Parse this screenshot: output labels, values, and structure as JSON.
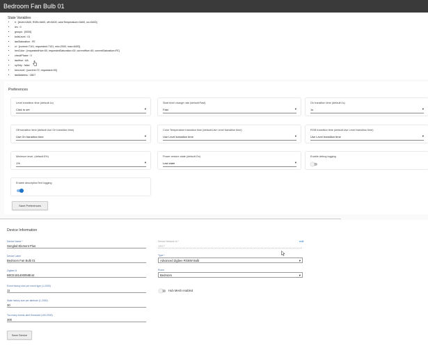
{
  "window": {
    "title": "Bedroom Fan Bulb 01"
  },
  "state": {
    "title": "State Variables",
    "items": [
      "rl : [level=0A00, RGB=0A00, off=0A00, colorTemperature=0A00, on=0A00]",
      "lim : 0",
      "groups : [0000]",
      "bulbLevel : 01",
      "lastSaturation : FE",
      "ct : [current=7101, requested=7101, min=2000, max=6493]",
      "hexColor : [requestedHue=00, requestedSaturation=00, currentHue=49, currentSaturation=FE]",
      "checkPhase : 0",
      "lastHue : AA",
      "xyOnly : false",
      "hexLevel : [current=72, requested=00]",
      "lastAddress : 1B27"
    ]
  },
  "preferences": {
    "title": "Preferences",
    "cards": [
      {
        "label": "Level transition time (default:1s)",
        "value": "Click to set"
      },
      {
        "label": "Start level change rate (default:Fast)",
        "value": "Fast"
      },
      {
        "label": "On transition time (default:1s)",
        "value": "1s"
      },
      {
        "label": "Off transition time (default:Use On transition time)",
        "value": "Use On transition time"
      },
      {
        "label": "Color Temperature transition time (default:Use Level transition time)",
        "value": "Use Level transition time"
      },
      {
        "label": "RGB transition time (default:Use Level transition time)",
        "value": "Use Level transition time"
      },
      {
        "label": "Minimum level, (default:5%)",
        "value": "1%"
      },
      {
        "label": "Power restore state (default:On)",
        "value": "Last state"
      }
    ],
    "debug_label": "Enable debug logging",
    "debug_on": false,
    "desc_label": "Enable descriptionText logging",
    "desc_on": true,
    "save_label": "Save Preferences"
  },
  "device": {
    "title": "Device Information",
    "name_label": "Device Name *",
    "name_value": "Sengled Element Plus",
    "device_label_label": "Device Label",
    "device_label_value": "Bedroom Fan Bulb 01",
    "zigbee_label": "Zigbee Id",
    "zigbee_value": "B0CE181400058E44",
    "event_hist_label": "Event history size per event type (1-2000)",
    "event_hist_value": "11",
    "state_hist_label": "State history size per attribute (1-2000)",
    "state_hist_value": "30",
    "too_many_label": "Too many events alert threshold (100-2000)",
    "too_many_value": "300",
    "network_label": "Device Network Id *",
    "network_value": "1B27",
    "network_edit": "edit",
    "type_label": "Type *",
    "type_value": "Advanced Zigbee RGBW Bulb",
    "room_label": "Room",
    "room_value": "Bedroom",
    "hub_mesh_label": "Hub Mesh enabled",
    "hub_mesh_on": false,
    "save_label": "Save Device"
  },
  "colors": {
    "titlebar": "#3a3a3a",
    "accent": "#1e73c8",
    "label_blue": "#4a6fa5"
  }
}
